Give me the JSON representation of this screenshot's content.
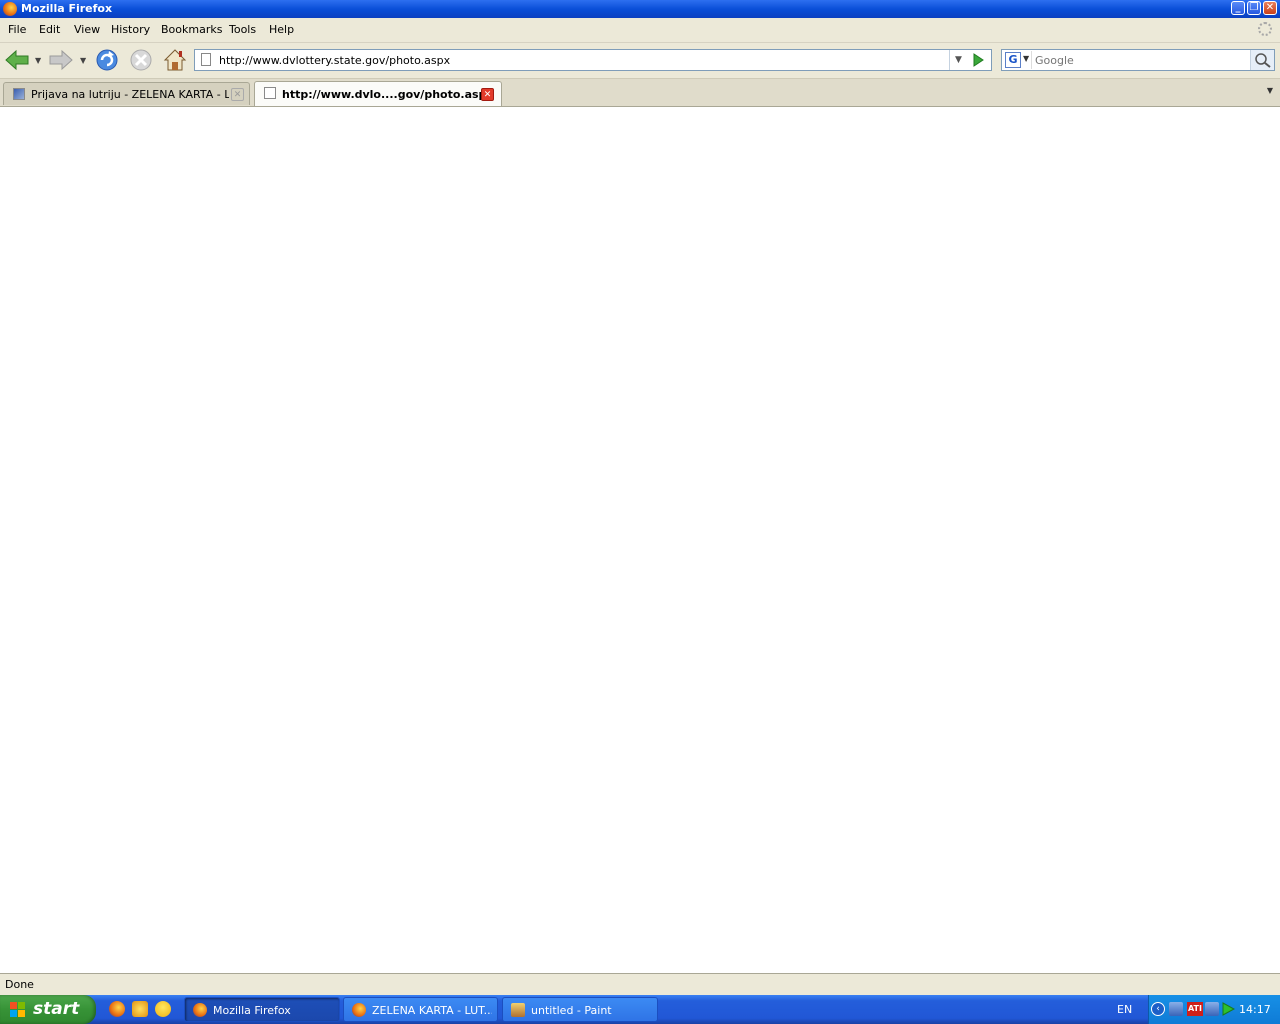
{
  "window": {
    "title": "Mozilla Firefox"
  },
  "menu": {
    "items": [
      "File",
      "Edit",
      "View",
      "History",
      "Bookmarks",
      "Tools",
      "Help"
    ]
  },
  "navigation": {
    "url": "http://www.dvlottery.state.gov/photo.aspx",
    "search_placeholder": "Google"
  },
  "tabs": [
    {
      "label": "Prijava na lutriju - ZELENA KARTA - LU...",
      "active": false
    },
    {
      "label": "http://www.dvlo....gov/photo.aspx",
      "active": true
    }
  ],
  "status": {
    "text": "Done"
  },
  "taskbar": {
    "start_label": "start",
    "tasks": [
      {
        "label": "Mozilla Firefox",
        "active": true
      },
      {
        "label": "ZELENA KARTA - LUT...",
        "active": false
      },
      {
        "label": "untitled - Paint",
        "active": false
      }
    ],
    "language": "EN",
    "clock": "14:17",
    "ati_label": "ATI"
  },
  "colors": {
    "titlebar": "#0a4fd8",
    "chrome": "#ece9d8",
    "taskbar": "#245edb",
    "start": "#379337"
  }
}
